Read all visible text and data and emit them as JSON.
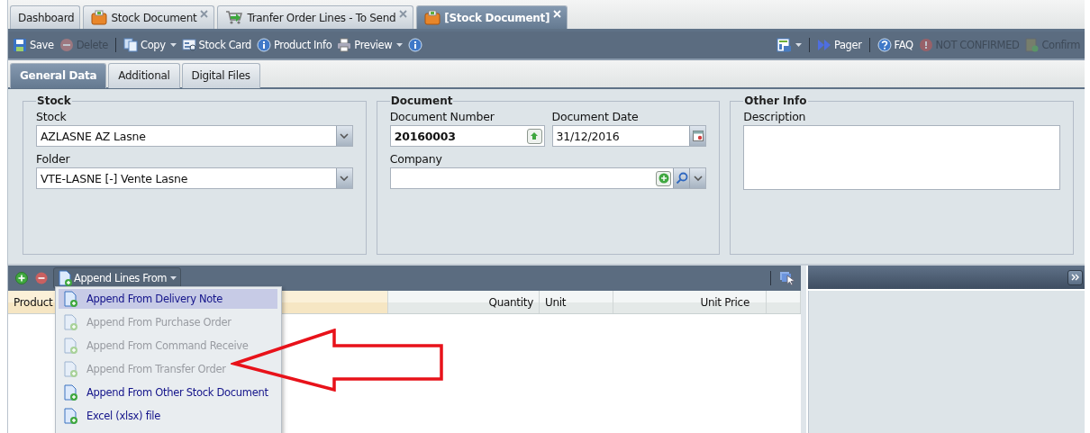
{
  "tabs": [
    {
      "label": "Dashboard",
      "kind": "plain",
      "closable": false,
      "selected": false
    },
    {
      "label": "Stock Document",
      "kind": "doc",
      "closable": true,
      "selected": false
    },
    {
      "label": "Tranfer Order Lines - To Send",
      "kind": "transfer",
      "closable": true,
      "selected": false
    },
    {
      "label": "[Stock Document]",
      "kind": "doc",
      "closable": true,
      "selected": true
    }
  ],
  "toolbar": {
    "left": [
      {
        "kind": "save",
        "label": "Save",
        "disabled": false,
        "dropdown": false
      },
      {
        "kind": "delete",
        "label": "Delete",
        "disabled": true,
        "dropdown": false
      },
      {
        "kind": "separator"
      },
      {
        "kind": "copy",
        "label": "Copy",
        "disabled": false,
        "dropdown": true
      },
      {
        "kind": "card",
        "label": "Stock Card",
        "disabled": false,
        "dropdown": false
      },
      {
        "kind": "info",
        "label": "Product Info",
        "disabled": false,
        "dropdown": false
      },
      {
        "kind": "print",
        "label": "Preview",
        "disabled": false,
        "dropdown": true
      },
      {
        "kind": "info",
        "disabled": false,
        "dropdown": false
      }
    ],
    "right": [
      {
        "kind": "layout",
        "disabled": false,
        "dropdown": true
      },
      {
        "kind": "separator"
      },
      {
        "kind": "pager",
        "label": "Pager",
        "disabled": false,
        "dropdown": false
      },
      {
        "kind": "separator"
      },
      {
        "kind": "help",
        "label": "FAQ",
        "disabled": false,
        "dropdown": false
      },
      {
        "kind": "alert",
        "label": "NOT CONFIRMED",
        "disabled": true,
        "dropdown": false
      },
      {
        "kind": "confirm",
        "label": "Confirm",
        "disabled": true,
        "dropdown": false
      }
    ]
  },
  "subtabs": [
    {
      "label": "General Data",
      "selected": true
    },
    {
      "label": "Additional",
      "selected": false
    },
    {
      "label": "Digital Files",
      "selected": false
    }
  ],
  "groups": [
    {
      "title": "Stock",
      "rows": [
        [
          {
            "label": "Stock",
            "kind": "combo",
            "value": "AZLASNE AZ Lasne"
          }
        ],
        [
          {
            "label": "Folder",
            "kind": "combo",
            "value": "VTE-LASNE [-] Vente Lasne"
          }
        ]
      ]
    },
    {
      "title": "Document",
      "rows": [
        [
          {
            "label": "Document Number",
            "kind": "number",
            "value": "20160003"
          },
          {
            "label": "Document Date",
            "kind": "date",
            "value": "31/12/2016"
          }
        ],
        [
          {
            "label": "Company",
            "kind": "lookup"
          }
        ]
      ]
    },
    {
      "title": "Other Info",
      "rows": [
        [
          {
            "label": "Description",
            "kind": "textarea"
          }
        ]
      ]
    }
  ],
  "lines": {
    "append_button": {
      "label": "Append Lines From"
    },
    "menu": [
      {
        "label": "Append From Delivery Note",
        "disabled": false,
        "selected": true
      },
      {
        "label": "Append From Purchase Order",
        "disabled": true,
        "selected": false
      },
      {
        "label": "Append From Command Receive",
        "disabled": true,
        "selected": false
      },
      {
        "label": "Append From Transfer Order",
        "disabled": true,
        "selected": false
      },
      {
        "label": "Append From Other Stock Document",
        "disabled": false,
        "selected": false
      },
      {
        "label": "Excel (xlsx) file",
        "disabled": false,
        "selected": false
      }
    ],
    "columns": [
      {
        "label": "Product",
        "sorted": true
      },
      {
        "label": "Quantity",
        "sorted": false
      },
      {
        "label": "Unit",
        "sorted": false
      },
      {
        "label": "Unit Price",
        "sorted": false
      },
      {
        "sorted": false
      }
    ]
  }
}
